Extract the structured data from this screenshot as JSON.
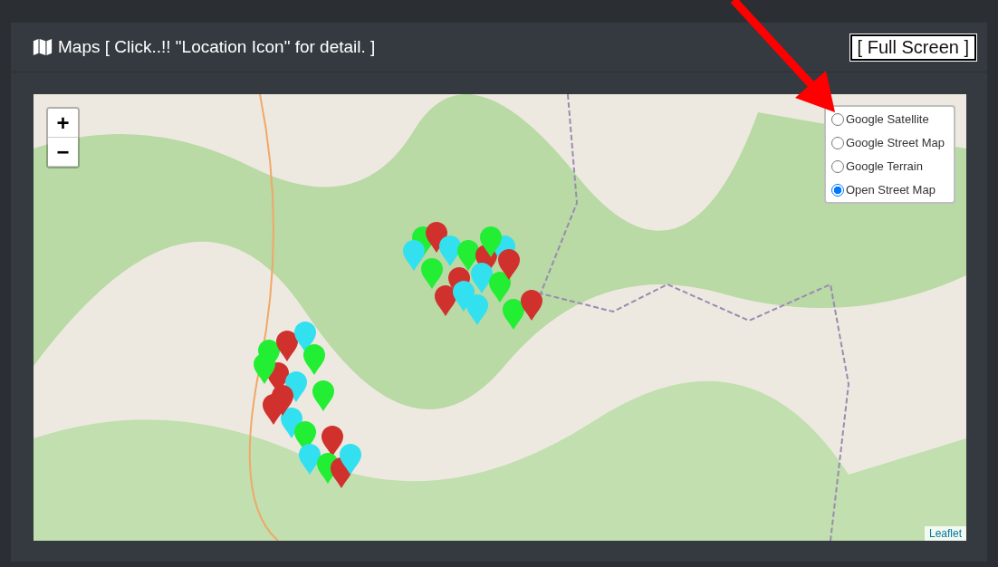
{
  "card": {
    "title": "Maps [ Click..!! \"Location Icon\" for detail. ]",
    "full_screen_button": "[ Full Screen ]"
  },
  "map": {
    "zoom_in": "+",
    "zoom_out": "−",
    "layers": [
      {
        "label": "Google Satellite",
        "selected": false
      },
      {
        "label": "Google Street Map",
        "selected": false
      },
      {
        "label": "Google Terrain",
        "selected": false
      },
      {
        "label": "Open Street Map",
        "selected": true
      }
    ],
    "attribution": "Leaflet"
  }
}
